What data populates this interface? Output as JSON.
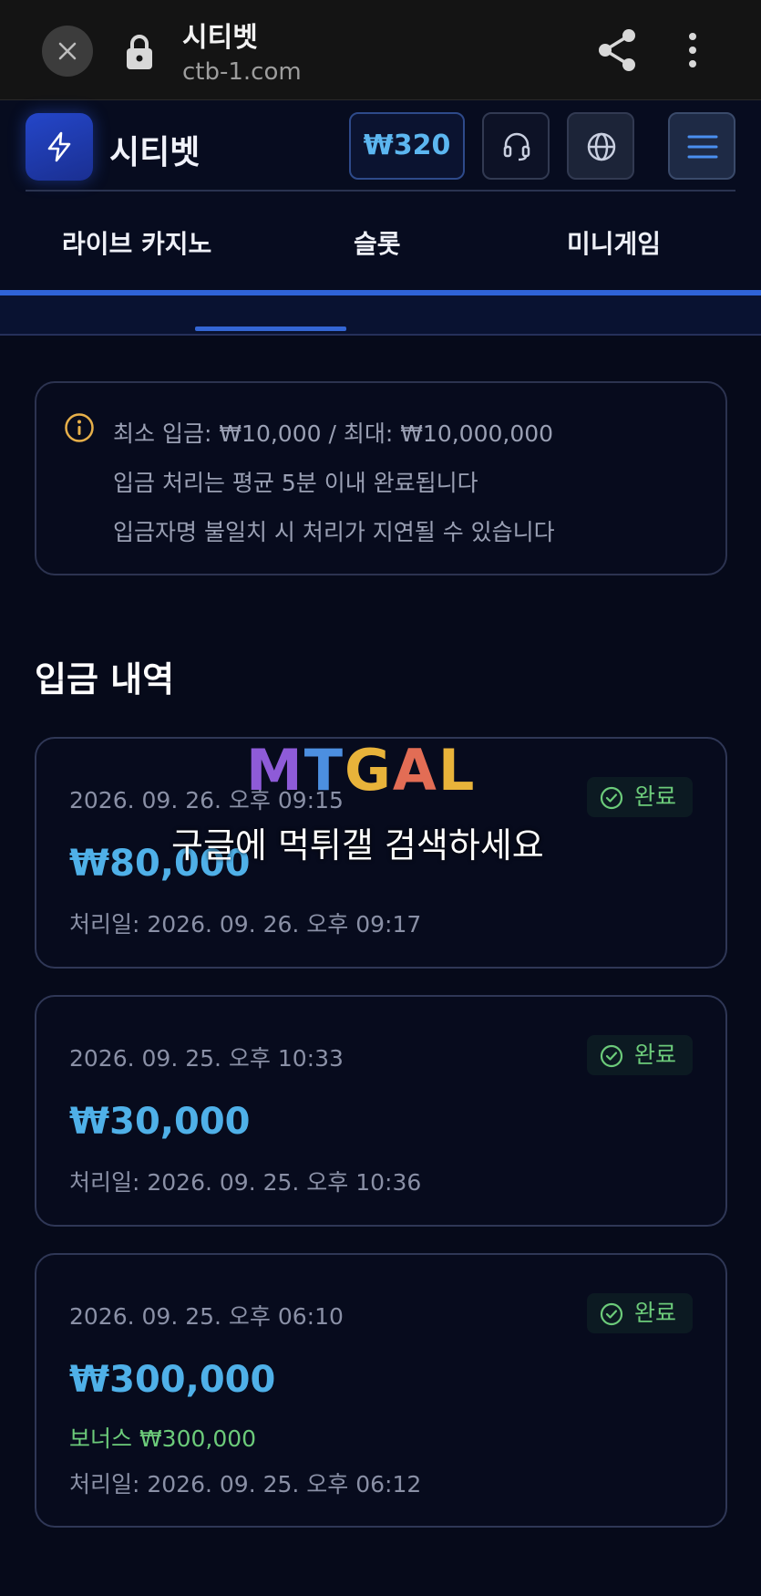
{
  "browser": {
    "title": "시티벳",
    "url": "ctb-1.com"
  },
  "header": {
    "brand": "시티벳",
    "balance": "₩320"
  },
  "nav": {
    "tabs": [
      "라이브 카지노",
      "슬롯",
      "미니게임"
    ]
  },
  "info": {
    "lines": [
      "최소 입금: ₩10,000 / 최대: ₩10,000,000",
      "입금 처리는 평균 5분 이내 완료됩니다",
      "입금자명 불일치 시 처리가 지연될 수 있습니다"
    ]
  },
  "history": {
    "title": "입금 내역",
    "items": [
      {
        "date": "2026. 09. 26. 오후 09:15",
        "status": "완료",
        "amount": "₩80,000",
        "processed": "처리일: 2026. 09. 26. 오후 09:17"
      },
      {
        "date": "2026. 09. 25. 오후 10:33",
        "status": "완료",
        "amount": "₩30,000",
        "processed": "처리일: 2026. 09. 25. 오후 10:36"
      },
      {
        "date": "2026. 09. 25. 오후 06:10",
        "status": "완료",
        "amount": "₩300,000",
        "bonus": "보너스 ₩300,000",
        "processed": "처리일: 2026. 09. 25. 오후 06:12"
      }
    ]
  },
  "watermark": {
    "logo": "MTGAL",
    "text": "구글에 먹튀갤 검색하세요"
  },
  "colors": {
    "accent": "#2f63d8",
    "amount": "#4fb0e8",
    "success": "#6ccb7a",
    "background": "#060a1a"
  }
}
